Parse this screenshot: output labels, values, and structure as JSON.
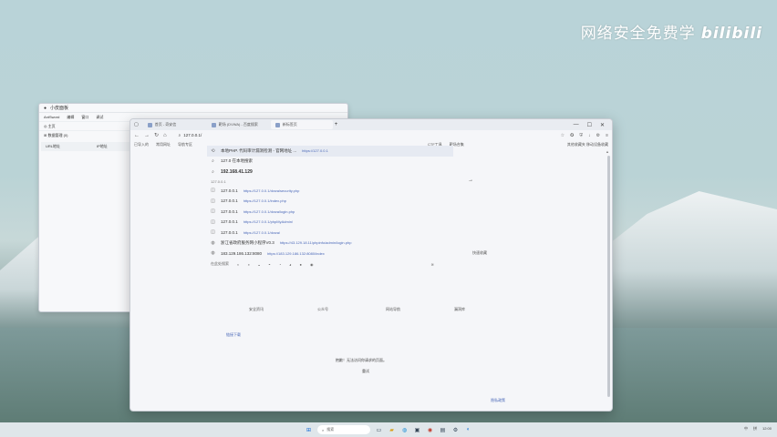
{
  "watermark": {
    "text": "网络安全免费学",
    "logo": "bilibili"
  },
  "back_window": {
    "title": "小皮面板",
    "menu": [
      "AntSword",
      "编辑",
      "窗口",
      "调试"
    ],
    "row1": "◎ 主页",
    "row2": "⊞ 数据管理 (0)",
    "table_headers": [
      "URL地址",
      "IP地址"
    ]
  },
  "browser": {
    "tabs": [
      {
        "label": "首页 - 奇安信"
      },
      {
        "label": "靶场 (DVWA) - 百度搜索"
      },
      {
        "label": "新标签页"
      }
    ],
    "window_controls": [
      "—",
      "☐",
      "✕"
    ],
    "address": "127.0.0.1/",
    "bookmarks": [
      "已导入的",
      "常用网址",
      "导航专区",
      "CTF工具",
      "靶场合集"
    ],
    "bookmarks_right": "其他收藏夹  移动设备收藏",
    "suggestions": [
      {
        "icon": "history",
        "text": "本地PHP. 代码审计漏洞检测 - 官网地址 ...",
        "url": "https://127.0.0.1"
      },
      {
        "icon": "search",
        "text": "127.0 在本地搜索",
        "url": ""
      },
      {
        "icon": "search",
        "text": "192.168.41.129",
        "url": ""
      }
    ],
    "section_label": "127.0.0.1",
    "history": [
      {
        "text": "127.0.0.1",
        "url": "https://127.0.0.1/dvwa/security.php"
      },
      {
        "text": "127.0.0.1",
        "url": "https://127.0.0.1/index.php"
      },
      {
        "text": "127.0.0.1",
        "url": "https://127.0.0.1/dvwa/login.php"
      },
      {
        "text": "127.0.0.1",
        "url": "https://127.0.0.1/phpMyAdmin/"
      },
      {
        "text": "127.0.0.1",
        "url": "https://127.0.0.1/dvwa/"
      },
      {
        "text": "浙江省政府服务网小程序V0.3",
        "url": "https://43.129.18.11/phpinfo/admin/login.php"
      },
      {
        "text": "183.129.186.132:8080",
        "url": "https://183.129.186.132:8080/index"
      }
    ],
    "engine_label": "在此处搜索",
    "side_label": "快速收藏",
    "columns": [
      "安全资讯",
      "公众号",
      "网站导航",
      "漏洞库"
    ],
    "note": "链接下载",
    "center_message": "抱歉！无法访问你请求的页面。",
    "center_button": "重试",
    "bottom_link": "隐私政策"
  },
  "taskbar": {
    "search_placeholder": "搜索",
    "tray": [
      "中",
      "拼",
      "12:00"
    ]
  }
}
